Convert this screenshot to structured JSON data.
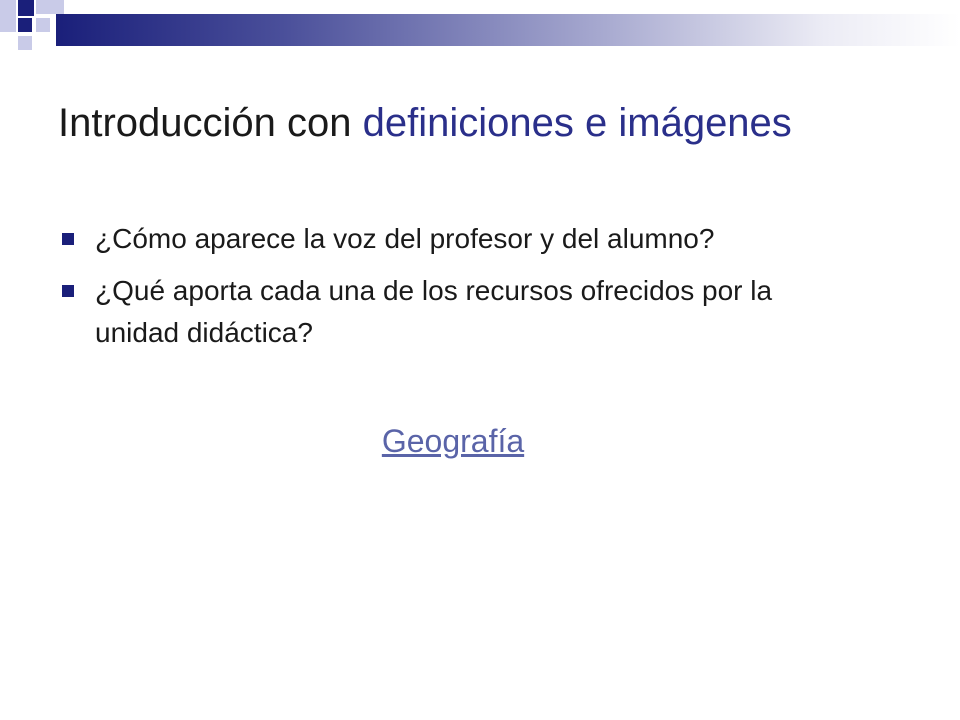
{
  "slide": {
    "title_part1": "Introducción con ",
    "title_part2": "definiciones e imágenes",
    "bullets": [
      {
        "text": "¿Cómo aparece la voz del profesor y del alumno?"
      },
      {
        "text": "¿Qué aporta cada una de los recursos ofrecidos por la unidad didáctica?"
      }
    ],
    "link_label": "Geografía"
  },
  "colors": {
    "accent": "#2a2f8a",
    "brand_dark": "#1a1f7a",
    "link": "#5a64a8"
  }
}
